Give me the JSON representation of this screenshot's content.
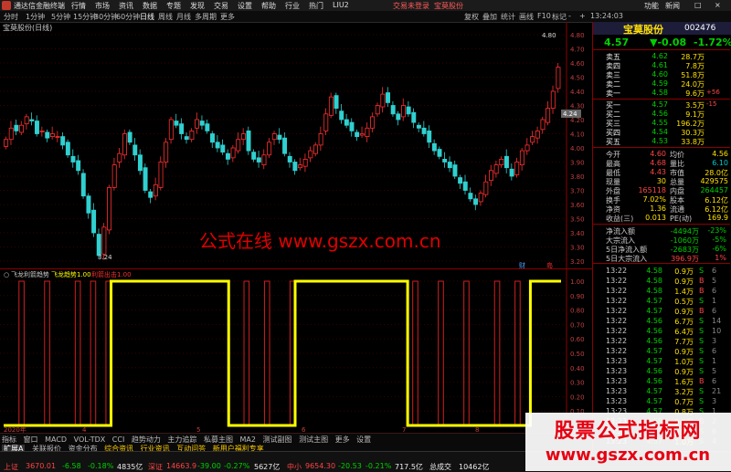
{
  "window": {
    "app_title": "通达信金融终端",
    "menu": [
      "行情",
      "市场",
      "资讯",
      "数据",
      "专题",
      "发现",
      "交易",
      "设置",
      "帮助",
      "行业",
      "热门",
      "LIU2"
    ],
    "warning": "交易未登录",
    "stock_link": "宝莫股份",
    "right_menu": [
      "功能",
      "新闻",
      "□",
      "×"
    ]
  },
  "toolbar": {
    "periods": [
      "分时",
      "1分钟",
      "5分钟",
      "15分钟",
      "30分钟",
      "60分钟",
      "日线",
      "周线",
      "月线",
      "多周期",
      "更多"
    ],
    "active_period": "日线",
    "right_items": [
      "复权",
      "叠加",
      "统计",
      "画线",
      "F10",
      "标记",
      "-",
      "+"
    ],
    "time": "13:24:03"
  },
  "chart": {
    "title": "宝莫股份(日线)",
    "overlay_text": "公式在线    www.gszx.com.cn",
    "y_ticks": [
      "4.80",
      "4.70",
      "4.60",
      "4.50",
      "4.40",
      "4.30",
      "4.20",
      "4.10",
      "4.00",
      "3.90",
      "3.80",
      "3.70",
      "3.60",
      "3.50",
      "3.40",
      "3.30",
      "3.20"
    ],
    "high_label": "4.80",
    "low_label": "3.24",
    "current_label": "4.24",
    "markers": [
      "财",
      "岛"
    ],
    "indicator_title": "飞龙利箭趋势",
    "indicator_series": [
      {
        "name": "飞龙趋势",
        "value": "1.00",
        "color": "#ffff00"
      },
      {
        "name": "利箭出击",
        "value": "1.00",
        "color": "#ff2020"
      }
    ],
    "ind_y_ticks": [
      "1.00",
      "0.90",
      "0.80",
      "0.70",
      "0.60",
      "0.50",
      "0.40",
      "0.30",
      "0.20",
      "0.10"
    ],
    "x_labels": [
      "2020年",
      "4",
      "5",
      "6",
      "7",
      "8"
    ],
    "chart_data": {
      "type": "candlestick",
      "ylim": [
        3.2,
        4.8
      ],
      "close": [
        4.06,
        4.14,
        4.12,
        4.16,
        4.22,
        4.19,
        4.1,
        4.12,
        4.07,
        4.1,
        4.08,
        4.02,
        3.95,
        3.9,
        3.84,
        3.66,
        3.54,
        3.4,
        3.24,
        3.44,
        3.72,
        3.88,
        3.96,
        4.1,
        4.04,
        3.95,
        3.84,
        3.7,
        3.65,
        3.74,
        3.9,
        4.04,
        4.2,
        4.16,
        4.1,
        4.06,
        4.12,
        4.2,
        4.16,
        4.12,
        4.04,
        4.0,
        3.97,
        3.92,
        4.0,
        4.06,
        4.1,
        3.98,
        3.92,
        3.9,
        3.95,
        4.04,
        4.1,
        4.06,
        3.96,
        3.9,
        3.84,
        3.88,
        3.92,
        3.98,
        4.02,
        4.1,
        4.24,
        4.36,
        4.28,
        4.2,
        4.16,
        4.12,
        4.08,
        4.1,
        4.14,
        4.22,
        4.3,
        4.38,
        4.32,
        4.24,
        4.2,
        4.3,
        4.24,
        4.18,
        4.14,
        4.1,
        4.04,
        3.98,
        3.94,
        3.9,
        3.86,
        3.8,
        3.75,
        3.7,
        3.64,
        3.6,
        3.68,
        3.76,
        3.84,
        3.88,
        3.92,
        3.86,
        3.8,
        3.9,
        3.98,
        4.02,
        4.08,
        4.12,
        4.2,
        4.28,
        4.4,
        4.57
      ],
      "indicator_yellow": [
        0,
        0,
        0,
        0,
        0,
        0,
        0,
        0,
        0,
        0,
        0,
        0,
        0,
        0,
        0,
        0,
        0,
        0,
        0,
        0,
        0,
        1,
        1,
        1,
        1,
        1,
        1,
        1,
        1,
        1,
        1,
        1,
        1,
        1,
        1,
        1,
        1,
        1,
        1,
        1,
        1,
        1,
        1,
        1,
        0,
        0,
        0,
        0,
        0,
        0,
        0,
        0,
        0,
        0,
        0,
        0,
        0,
        1,
        1,
        1,
        1,
        1,
        1,
        1,
        1,
        1,
        1,
        1,
        1,
        1,
        1,
        1,
        1,
        1,
        1,
        1,
        1,
        1,
        1,
        0,
        0,
        0,
        0,
        0,
        0,
        0,
        0,
        0,
        0,
        0,
        0,
        0,
        0,
        0,
        0,
        0,
        0,
        0,
        0,
        0,
        0,
        0,
        0,
        1,
        1,
        1,
        1,
        1,
        1
      ],
      "indicator_red_spikes": [
        3,
        8,
        14,
        17,
        20,
        28,
        33,
        40,
        47,
        51,
        56,
        62,
        69,
        73,
        80,
        85,
        90,
        96,
        100,
        104
      ]
    }
  },
  "bottom_tabs": {
    "row1": [
      "指标",
      "窗口",
      "MACD",
      "VOL-TDX",
      "CCI",
      "趋势动力",
      "主力追踪",
      "私募主图",
      "MA2",
      "测试副图",
      "测试主图",
      "更多",
      "设置"
    ],
    "row2": [
      "扩展A",
      "关联报价",
      "资金分布",
      "综合资讯",
      "行业资讯",
      "互动问答",
      "新用户福利专享"
    ]
  },
  "quote": {
    "name": "宝莫股份",
    "code": "002476",
    "last": "4.57",
    "change": "▼-0.08",
    "change_pct": "-1.72%",
    "asks": [
      {
        "label": "卖五",
        "price": "4.62",
        "vol": "28.7万",
        "extra": ""
      },
      {
        "label": "卖四",
        "price": "4.61",
        "vol": "7.8万",
        "extra": ""
      },
      {
        "label": "卖三",
        "price": "4.60",
        "vol": "51.8万",
        "extra": ""
      },
      {
        "label": "卖二",
        "price": "4.59",
        "vol": "24.0万",
        "extra": ""
      },
      {
        "label": "卖一",
        "price": "4.58",
        "vol": "9.6万",
        "extra": "+56"
      }
    ],
    "bids": [
      {
        "label": "买一",
        "price": "4.57",
        "vol": "3.5万",
        "extra": "-15"
      },
      {
        "label": "买二",
        "price": "4.56",
        "vol": "9.1万",
        "extra": ""
      },
      {
        "label": "买三",
        "price": "4.55",
        "vol": "196.2万",
        "extra": ""
      },
      {
        "label": "买四",
        "price": "4.54",
        "vol": "30.3万",
        "extra": ""
      },
      {
        "label": "买五",
        "price": "4.53",
        "vol": "33.8万",
        "extra": ""
      }
    ],
    "stats": [
      {
        "l1": "今开",
        "v1": "4.60",
        "l2": "均价",
        "v2": "4.56"
      },
      {
        "l1": "最高",
        "v1": "4.68",
        "l2": "量比",
        "v2": "6.10"
      },
      {
        "l1": "最低",
        "v1": "4.43",
        "l2": "市值",
        "v2": "28.0亿"
      },
      {
        "l1": "现量",
        "v1": "30",
        "l2": "总量",
        "v2": "429575"
      },
      {
        "l1": "外盘",
        "v1": "165118",
        "l2": "内盘",
        "v2": "264457"
      },
      {
        "l1": "换手",
        "v1": "7.02%",
        "l2": "股本",
        "v2": "6.12亿"
      },
      {
        "l1": "净资",
        "v1": "1.36",
        "l2": "流通",
        "v2": "6.12亿"
      },
      {
        "l1": "收益(三)",
        "v1": "0.013",
        "l2": "PE(动)",
        "v2": "169.9"
      }
    ],
    "flows": [
      {
        "label": "净流入额",
        "value": "-4494万",
        "pct": "-23%"
      },
      {
        "label": "大宗流入",
        "value": "-1060万",
        "pct": "-5%"
      },
      {
        "label": "5日净流入额",
        "value": "-2683万",
        "pct": "-6%"
      },
      {
        "label": "5日大宗流入",
        "value": "396.9万",
        "pct": "1%"
      }
    ],
    "ticks": [
      {
        "t": "13:22",
        "p": "4.58",
        "v": "0.9万",
        "d": "S",
        "n": "6"
      },
      {
        "t": "13:22",
        "p": "4.58",
        "v": "0.9万",
        "d": "B",
        "n": "5"
      },
      {
        "t": "13:22",
        "p": "4.58",
        "v": "1.4万",
        "d": "B",
        "n": "6"
      },
      {
        "t": "13:22",
        "p": "4.57",
        "v": "0.5万",
        "d": "S",
        "n": "1"
      },
      {
        "t": "13:22",
        "p": "4.57",
        "v": "0.9万",
        "d": "B",
        "n": "6"
      },
      {
        "t": "13:22",
        "p": "4.56",
        "v": "6.7万",
        "d": "S",
        "n": "14"
      },
      {
        "t": "13:22",
        "p": "4.56",
        "v": "6.4万",
        "d": "S",
        "n": "10"
      },
      {
        "t": "13:22",
        "p": "4.56",
        "v": "7.7万",
        "d": "S",
        "n": "3"
      },
      {
        "t": "13:22",
        "p": "4.57",
        "v": "0.9万",
        "d": "S",
        "n": "6"
      },
      {
        "t": "13:23",
        "p": "4.57",
        "v": "1.0万",
        "d": "S",
        "n": "1"
      },
      {
        "t": "13:23",
        "p": "4.56",
        "v": "0.9万",
        "d": "S",
        "n": "5"
      },
      {
        "t": "13:23",
        "p": "4.56",
        "v": "1.6万",
        "d": "B",
        "n": "6"
      },
      {
        "t": "13:23",
        "p": "4.57",
        "v": "3.2万",
        "d": "S",
        "n": "21"
      },
      {
        "t": "13:23",
        "p": "4.57",
        "v": "0.7万",
        "d": "S",
        "n": "3"
      },
      {
        "t": "13:23",
        "p": "4.57",
        "v": "0.8万",
        "d": "S",
        "n": "1"
      },
      {
        "t": "13:23",
        "p": "4.58",
        "v": "0.2万",
        "d": "B",
        "n": "2"
      },
      {
        "t": "13:23",
        "p": "4.57",
        "v": "0.9万",
        "d": "S",
        "n": "6"
      },
      {
        "t": "13:23",
        "p": "4.57",
        "v": "1.0万",
        "d": "S",
        "n": "4"
      }
    ]
  },
  "status": {
    "sh": {
      "label": "上证",
      "value": "3670.01",
      "chg": "-6.58",
      "pct": "-0.18%",
      "amt": "4835亿"
    },
    "sz": {
      "label": "深证",
      "value": "14663.9",
      "chg": "-39.00",
      "pct": "-0.27%",
      "amt": "5627亿"
    },
    "cyb": {
      "label": "中小",
      "value": "9654.30",
      "chg": "-20.53",
      "pct": "-0.21%",
      "amt": "717.5亿"
    },
    "extra": "总成交",
    "extra2": "10462亿"
  },
  "watermark": {
    "line1": "股票公式指标网",
    "line2": "www.gszx.com.cn"
  },
  "colors": {
    "up": "#ff3030",
    "down": "#00d0d0",
    "bg": "#000000",
    "accent": "#ffe000"
  }
}
